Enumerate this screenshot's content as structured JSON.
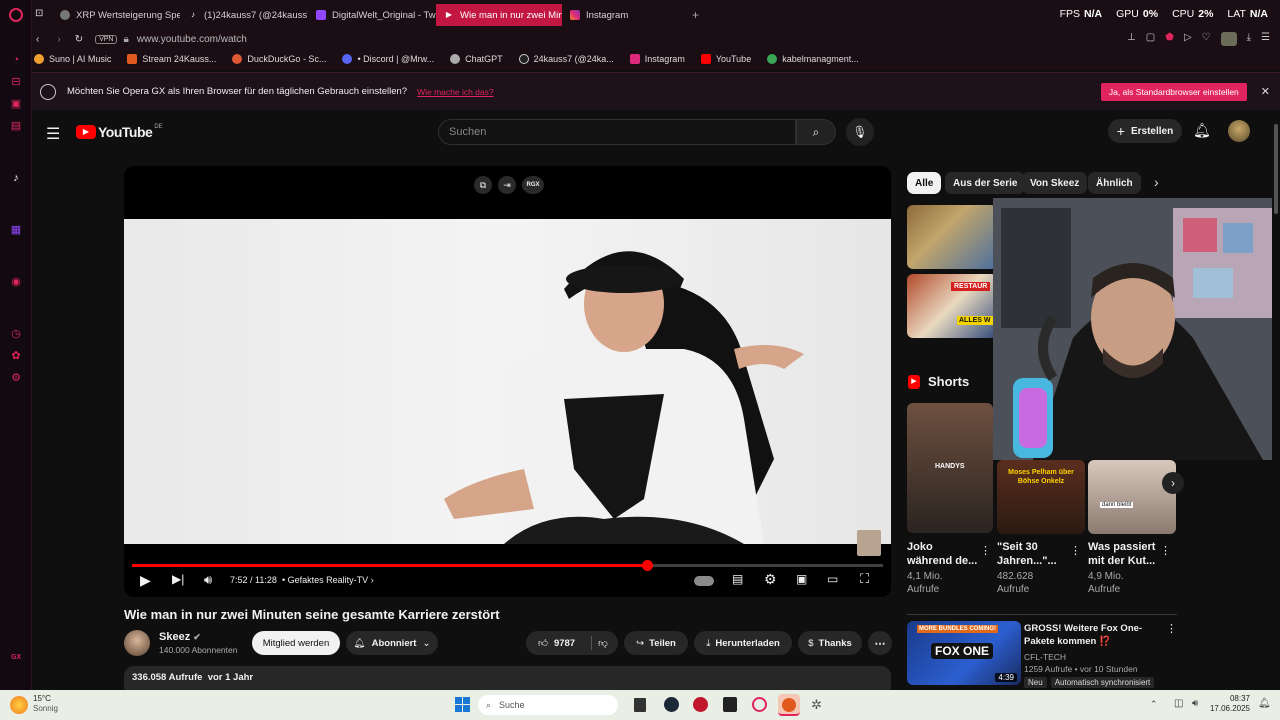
{
  "browser": {
    "tabs": [
      {
        "label": "XRP Wertsteigerung Spe"
      },
      {
        "label": "(1)24kauss7 (@24kauss7"
      },
      {
        "label": "DigitalWelt_Original - Twi"
      },
      {
        "label": "Wie man in nur zwei Minu"
      },
      {
        "label": "Instagram"
      }
    ],
    "stats": [
      {
        "key": "FPS",
        "value": "N/A"
      },
      {
        "key": "GPU",
        "value": "0%"
      },
      {
        "key": "CPU",
        "value": "2%"
      },
      {
        "key": "LAT",
        "value": "N/A"
      }
    ],
    "vpn_label": "VPN",
    "url": "www.youtube.com/watch",
    "bookmarks": [
      {
        "label": "Suno | AI Music"
      },
      {
        "label": "Stream 24Kauss..."
      },
      {
        "label": "DuckDuckGo - Sc..."
      },
      {
        "label": "• Discord | @Mrw..."
      },
      {
        "label": "ChatGPT"
      },
      {
        "label": "24kauss7 (@24ka..."
      },
      {
        "label": "Instagram"
      },
      {
        "label": "YouTube"
      },
      {
        "label": "kabelmanagment..."
      }
    ],
    "default_prompt": {
      "text": "Möchten Sie Opera GX als Ihren Browser für den täglichen Gebrauch einstellen?",
      "link": "Wie mache ich das?",
      "button": "Ja, als Standardbrowser einstellen"
    }
  },
  "youtube": {
    "logo": "YouTube",
    "country": "DE",
    "search_placeholder": "Suchen",
    "create_label": "Erstellen",
    "player": {
      "time": "7:52 / 11:28",
      "chapter": "Gefaktes Reality-TV",
      "overlay_badge": "RGX",
      "progress": 0.686
    },
    "video": {
      "title": "Wie man in nur zwei Minuten seine gesamte Karriere zerstört",
      "channel": "Skeez",
      "subscribers": "140.000 Abonnenten",
      "join_label": "Mitglied werden",
      "subscribed_label": "Abonniert",
      "likes": "9787",
      "share_label": "Teilen",
      "download_label": "Herunterladen",
      "thanks_label": "Thanks",
      "views": "336.058 Aufrufe",
      "age": "vor 1 Jahr"
    },
    "chips": [
      "Alle",
      "Aus der Serie",
      "Von Skeez",
      "Ähnlich"
    ],
    "thumb_texts": {
      "restaurant": "RESTAUR",
      "alles": "ALLES W"
    },
    "shorts_heading": "Shorts",
    "shorts": [
      {
        "title1": "Joko",
        "title2": "während de...",
        "views": "4,1 Mio.",
        "views2": "Aufrufe",
        "overlay": "HANDYS"
      },
      {
        "title1": "\"Seit 30",
        "title2": "Jahren...\"...",
        "views": "482.628",
        "views2": "Aufrufe",
        "overlay": "Moses Pelham über Böhse Onkelz"
      },
      {
        "title1": "Was passiert",
        "title2": "mit der Kut...",
        "views": "4,9 Mio.",
        "views2": "Aufrufe",
        "overlay": "dann bleibt"
      }
    ],
    "rec": {
      "title1": "GROSS! Weitere Fox One-",
      "title2": "Pakete kommen ⁉️",
      "channel": "CFL-TECH",
      "meta": "1259 Aufrufe • vor 10 Stunden",
      "badge_new": "Neu",
      "badge_sync": "Automatisch synchronisiert",
      "duration": "4:39",
      "thumb_top": "MORE BUNDLES COMING!",
      "thumb_main": "FOX ONE"
    }
  },
  "taskbar": {
    "temp": "15°C",
    "weather": "Sonnig",
    "search": "Suche",
    "time": "08:37",
    "date": "17.06.2025"
  },
  "sidebar": {
    "gx_label": "GX"
  },
  "colors": {
    "accent": "#e0245e",
    "yt_red": "#ff0000",
    "opera_btn": "#e0245e"
  }
}
